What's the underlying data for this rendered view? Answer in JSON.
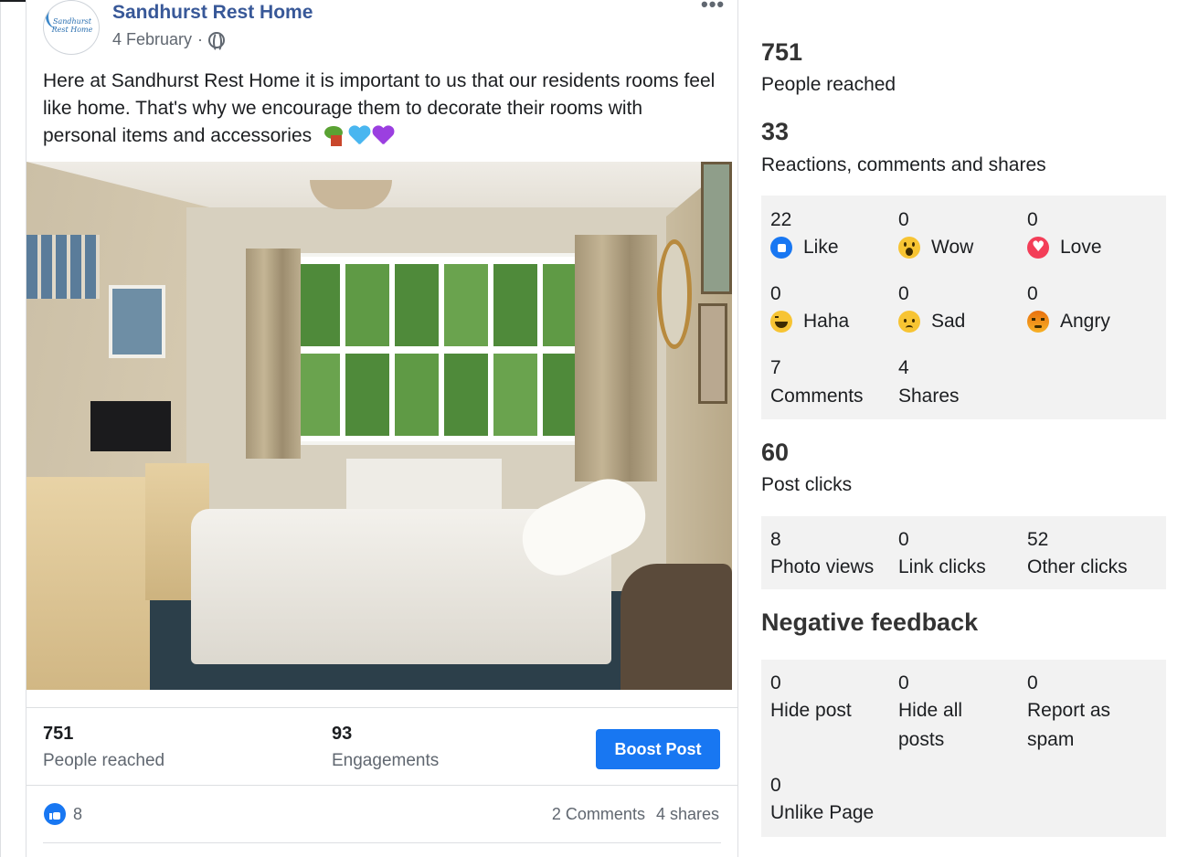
{
  "post": {
    "page_name": "Sandhurst Rest Home",
    "avatar_text": "Sandhurst Rest Home",
    "date": "4 February",
    "separator": "·",
    "more_label": "•••",
    "text": "Here at Sandhurst Rest Home it is important to us that our residents rooms feel like home. That's why we encourage them to decorate their rooms with personal items and accessories",
    "emojis": [
      "house-with-garden-emoji",
      "blue-heart-emoji",
      "purple-heart-emoji"
    ],
    "stats": {
      "reached_value": "751",
      "reached_label": "People reached",
      "engagements_value": "93",
      "engagements_label": "Engagements",
      "boost_label": "Boost Post"
    },
    "footer": {
      "like_count": "8",
      "comments": "2 Comments",
      "shares": "4 shares"
    }
  },
  "insights": {
    "reached_value": "751",
    "reached_label": "People reached",
    "reactions_value": "33",
    "reactions_label": "Reactions, comments and shares",
    "reactions": [
      {
        "count": "22",
        "label": "Like",
        "icon": "like-icon"
      },
      {
        "count": "0",
        "label": "Wow",
        "icon": "wow-icon"
      },
      {
        "count": "0",
        "label": "Love",
        "icon": "love-icon"
      },
      {
        "count": "0",
        "label": "Haha",
        "icon": "haha-icon"
      },
      {
        "count": "0",
        "label": "Sad",
        "icon": "sad-icon"
      },
      {
        "count": "0",
        "label": "Angry",
        "icon": "angry-icon"
      }
    ],
    "comments": {
      "count": "7",
      "label": "Comments"
    },
    "shares": {
      "count": "4",
      "label": "Shares"
    },
    "clicks_value": "60",
    "clicks_label": "Post clicks",
    "clicks": [
      {
        "count": "8",
        "label": "Photo views"
      },
      {
        "count": "0",
        "label": "Link clicks"
      },
      {
        "count": "52",
        "label": "Other clicks"
      }
    ],
    "negative_title": "Negative feedback",
    "negative": [
      {
        "count": "0",
        "label_1": "Hide post",
        "label_2": ""
      },
      {
        "count": "0",
        "label_1": "Hide all",
        "label_2": "posts"
      },
      {
        "count": "0",
        "label_1": "Report as",
        "label_2": "spam"
      },
      {
        "count": "0",
        "label_1": "Unlike Page",
        "label_2": ""
      }
    ]
  },
  "colors": {
    "brand_blue": "#1877f2",
    "page_name": "#385898",
    "panel_grey": "#f2f2f2"
  }
}
